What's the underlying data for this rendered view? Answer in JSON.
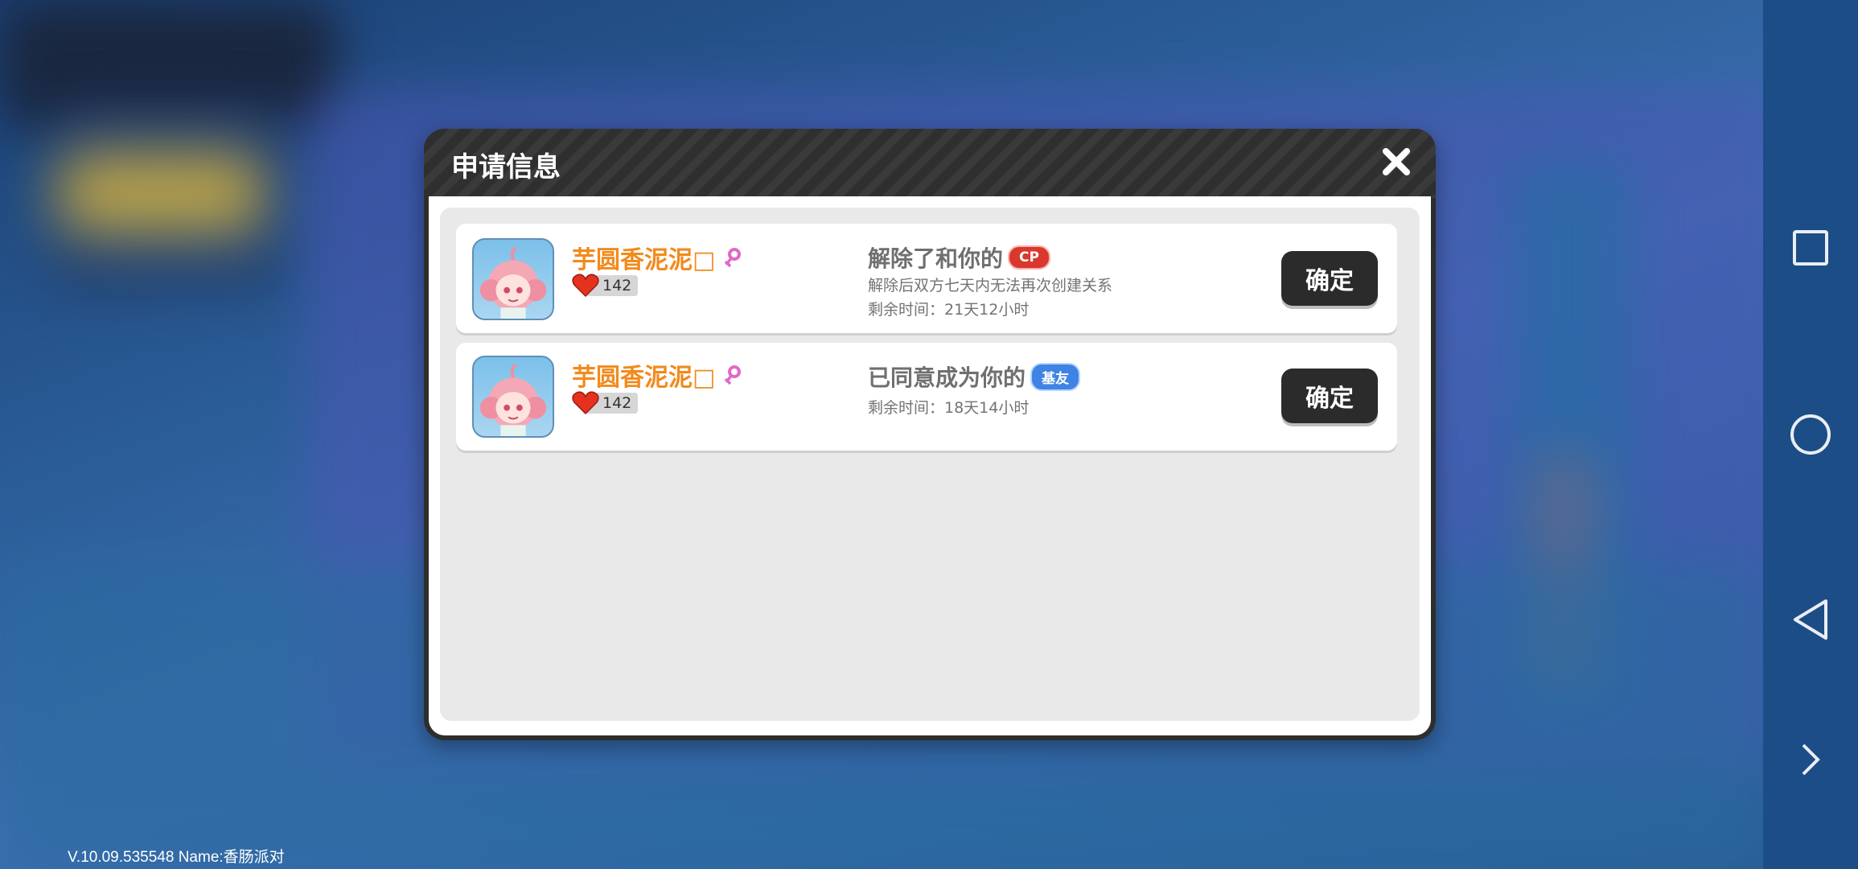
{
  "dialog": {
    "title": "申请信息"
  },
  "requests": [
    {
      "username": "芋圆香泥泥□",
      "heart_count": "142",
      "message": "解除了和你的",
      "tag": "CP",
      "detail": "解除后双方七天内无法再次创建关系",
      "remaining": "剩余时间：21天12小时",
      "button": "确定"
    },
    {
      "username": "芋圆香泥泥□",
      "heart_count": "142",
      "message": "已同意成为你的",
      "tag": "基友",
      "remaining": "剩余时间：18天14小时",
      "button": "确定"
    }
  ],
  "footer": {
    "version": "V.10.09.535548 Name:香肠派对"
  },
  "colors": {
    "username": "#f28a1c",
    "tag_cp": "#d8382e",
    "tag_jiyou": "#3f84e4",
    "button_bg": "#2b2b2b"
  }
}
